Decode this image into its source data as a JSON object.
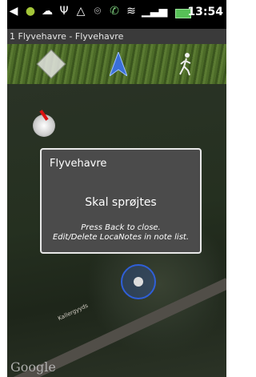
{
  "status_bar": {
    "icons": [
      "back-arrow-icon",
      "android-icon",
      "sync-icon",
      "usb-icon",
      "warning-icon",
      "location-pin-icon",
      "phone-icon",
      "wifi-icon",
      "signal-icon",
      "battery-icon"
    ],
    "time": "13:54"
  },
  "title_bar": {
    "text": "1 Flyvehavre - Flyvehavre"
  },
  "toolbar": {
    "buttons": [
      "directions-icon",
      "navigation-arrow-icon",
      "walking-person-icon"
    ]
  },
  "map": {
    "road_label": "Kallergyyds",
    "attribution": "Google"
  },
  "dialog": {
    "title": "Flyvehavre",
    "note": "Skal sprøjtes",
    "hint_line1": "Press Back to close.",
    "hint_line2": "Edit/Delete LocaNotes in note list."
  },
  "colors": {
    "dialog_bg": "#4b4b4b",
    "location_ring": "#2f5fd8",
    "battery": "#57c057"
  }
}
